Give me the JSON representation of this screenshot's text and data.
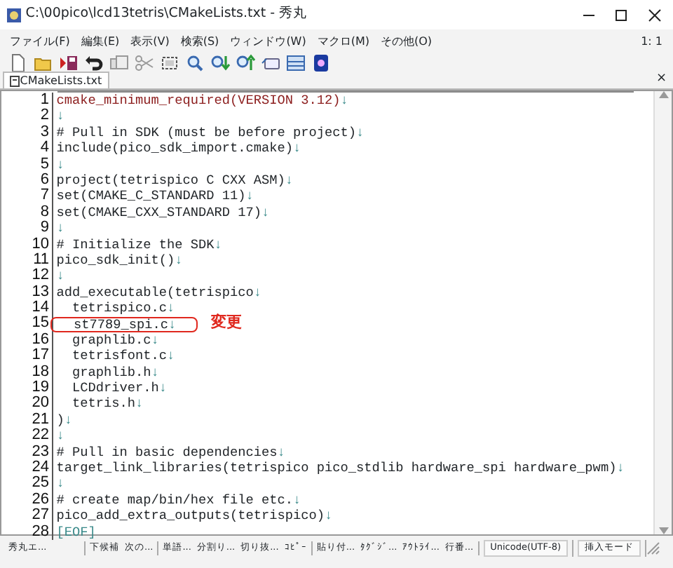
{
  "window": {
    "title": "C:\\00pico\\lcd13tetris\\CMakeLists.txt - 秀丸"
  },
  "menu": [
    "ファイル(F)",
    "編集(E)",
    "表示(V)",
    "検索(S)",
    "ウィンドウ(W)",
    "マクロ(M)",
    "その他(O)"
  ],
  "cursor_position": "1: 1",
  "toolbar": [
    {
      "kind": "new"
    },
    {
      "kind": "open"
    },
    {
      "kind": "save"
    },
    {
      "kind": "undo"
    },
    {
      "kind": "copy"
    },
    {
      "kind": "cut"
    },
    {
      "kind": "select"
    },
    {
      "kind": "search"
    },
    {
      "kind": "search-down"
    },
    {
      "kind": "search-up"
    },
    {
      "kind": "tag"
    },
    {
      "kind": "window"
    },
    {
      "kind": "help"
    }
  ],
  "tab": {
    "label": "CMakeLists.txt",
    "close": "×"
  },
  "lines": [
    {
      "number": "1",
      "text": "cmake_minimum_required(VERSION 3.12)",
      "eol": "↓",
      "current": true
    },
    {
      "number": "2",
      "eol": "↓",
      "current": false
    },
    {
      "number": "3",
      "text": "# Pull in SDK (must be before project)",
      "eol": "↓",
      "current": false
    },
    {
      "number": "4",
      "text": "include(pico_sdk_import.cmake)",
      "eol": "↓",
      "current": false
    },
    {
      "number": "5",
      "eol": "↓",
      "current": false
    },
    {
      "number": "6",
      "text": "project(tetrispico C CXX ASM)",
      "eol": "↓",
      "current": false
    },
    {
      "number": "7",
      "text": "set(CMAKE_C_STANDARD 11)",
      "eol": "↓",
      "current": false
    },
    {
      "number": "8",
      "text": "set(CMAKE_CXX_STANDARD 17)",
      "eol": "↓",
      "current": false
    },
    {
      "number": "9",
      "eol": "↓",
      "current": false
    },
    {
      "number": "10",
      "text": "# Initialize the SDK",
      "eol": "↓",
      "current": false
    },
    {
      "number": "11",
      "text": "pico_sdk_init()",
      "eol": "↓",
      "current": false
    },
    {
      "number": "12",
      "eol": "↓",
      "current": false
    },
    {
      "number": "13",
      "text": "add_executable(tetrispico",
      "eol": "↓",
      "current": false
    },
    {
      "number": "14",
      "text": "  tetrispico.c",
      "eol": "↓",
      "current": false
    },
    {
      "number": "15",
      "text": "  st7789_spi.c",
      "eol": "↓",
      "current": false,
      "circled": true,
      "note": "変更"
    },
    {
      "number": "16",
      "text": "  graphlib.c",
      "eol": "↓",
      "current": false
    },
    {
      "number": "17",
      "text": "  tetrisfont.c",
      "eol": "↓",
      "current": false
    },
    {
      "number": "18",
      "text": "  graphlib.h",
      "eol": "↓",
      "current": false
    },
    {
      "number": "19",
      "text": "  LCDdriver.h",
      "eol": "↓",
      "current": false
    },
    {
      "number": "20",
      "text": "  tetris.h",
      "eol": "↓",
      "current": false
    },
    {
      "number": "21",
      "text": ")",
      "eol": "↓",
      "current": false
    },
    {
      "number": "22",
      "eol": "↓",
      "current": false
    },
    {
      "number": "23",
      "text": "# Pull in basic dependencies",
      "eol": "↓",
      "current": false
    },
    {
      "number": "24",
      "text": "target_link_libraries(tetrispico pico_stdlib hardware_spi hardware_pwm)",
      "eol": "↓",
      "current": false
    },
    {
      "number": "25",
      "eol": "↓",
      "current": false
    },
    {
      "number": "26",
      "text": "# create map/bin/hex file etc.",
      "eol": "↓",
      "current": false
    },
    {
      "number": "27",
      "text": "pico_add_extra_outputs(tetrispico)",
      "eol": "↓",
      "current": false
    },
    {
      "number": "28",
      "text": "[EOF]",
      "kind": "eof",
      "current": false
    }
  ],
  "status_bar": [
    [
      "秀丸エ..."
    ],
    [
      "下候補",
      "次の..."
    ],
    [
      "単語...",
      "分割り...",
      "切り抜...",
      "ｺﾋﾟｰ"
    ],
    [
      "貼り付...",
      "ﾀｸﾞｼﾞ...",
      "ｱｳﾄﾗｲ...",
      "行番..."
    ],
    [
      "Unicode(UTF-8)"
    ],
    [
      "挿入モード"
    ]
  ]
}
